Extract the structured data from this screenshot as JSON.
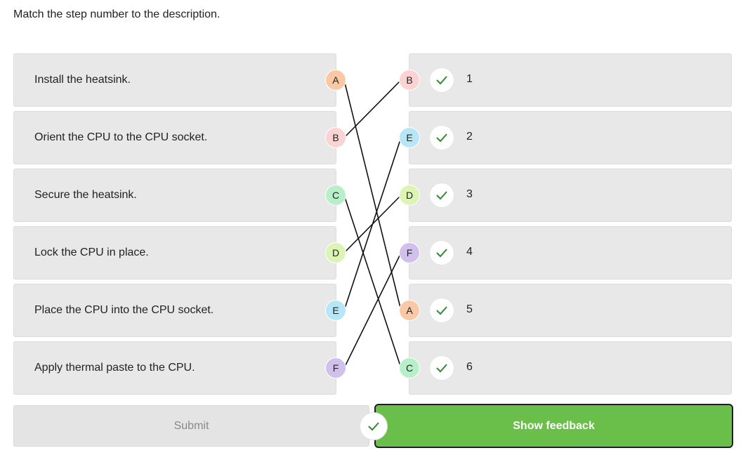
{
  "instruction": "Match the step number to the description.",
  "left_items": [
    {
      "description": "Install the heatsink.",
      "letter": "A",
      "color": "#f9c9a6"
    },
    {
      "description": "Orient the CPU to the CPU socket.",
      "letter": "B",
      "color": "#fbd3d3"
    },
    {
      "description": "Secure the heatsink.",
      "letter": "C",
      "color": "#b7efcb"
    },
    {
      "description": "Lock the CPU in place.",
      "letter": "D",
      "color": "#dcf5b4"
    },
    {
      "description": "Place the CPU into the CPU socket.",
      "letter": "E",
      "color": "#b7e6f7"
    },
    {
      "description": "Apply thermal paste to the CPU.",
      "letter": "F",
      "color": "#d2c0ec"
    }
  ],
  "right_items": [
    {
      "letter": "B",
      "number": "1",
      "color": "#fbd3d3",
      "status_icon": "check-icon"
    },
    {
      "letter": "E",
      "number": "2",
      "color": "#b7e6f7",
      "status_icon": "check-icon"
    },
    {
      "letter": "D",
      "number": "3",
      "color": "#dcf5b4",
      "status_icon": "check-icon"
    },
    {
      "letter": "F",
      "number": "4",
      "color": "#d2c0ec",
      "status_icon": "check-icon"
    },
    {
      "letter": "A",
      "number": "5",
      "color": "#f9c9a6",
      "status_icon": "check-icon"
    },
    {
      "letter": "C",
      "number": "6",
      "color": "#b7efcb",
      "status_icon": "check-icon"
    }
  ],
  "submit_label": "Submit",
  "feedback_label": "Show feedback",
  "colors": {
    "feedback_button": "#6abf4b",
    "check": "#2e8b2e",
    "card": "#e8e8e8"
  }
}
